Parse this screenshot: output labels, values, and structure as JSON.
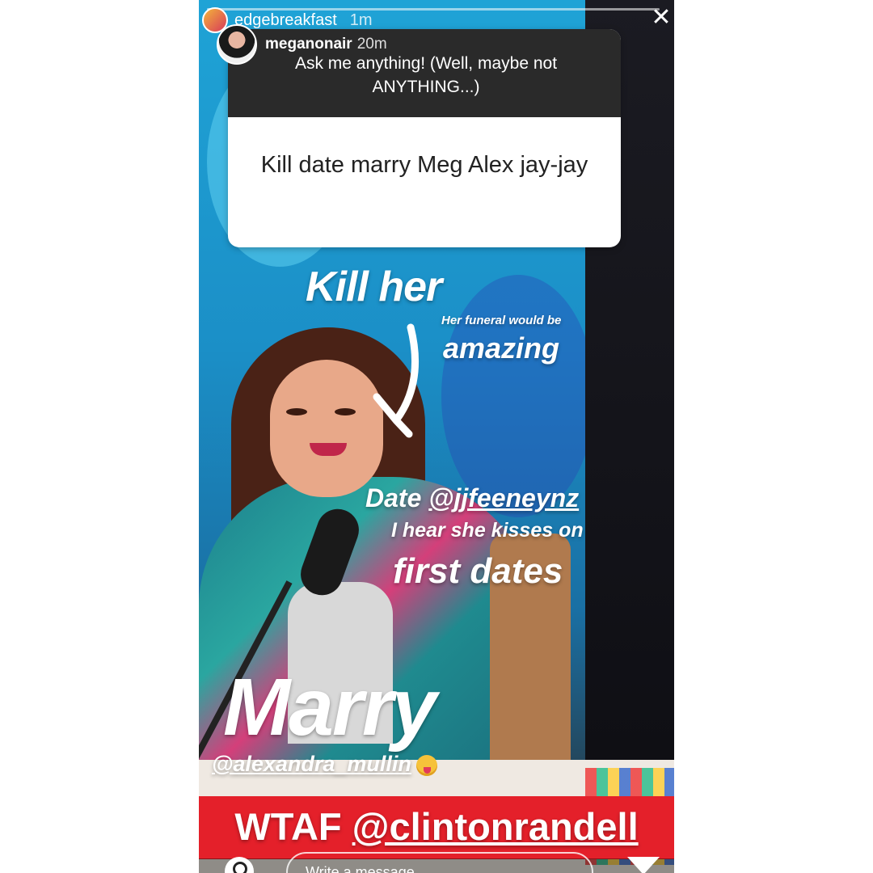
{
  "story_header": {
    "username": "edgebreakfast",
    "time": "1m"
  },
  "question_sticker": {
    "username": "meganonair",
    "time": "20m",
    "prompt": "Ask me anything! (Well, maybe not ANYTHING...)",
    "answer": "Kill date marry Meg Alex jay-jay"
  },
  "overlays": {
    "kill": "Kill her",
    "funeral_small": "Her funeral would be",
    "funeral_big": "amazing",
    "date_prefix": "Date ",
    "date_mention": "@jjfeeneynz",
    "date_line2": "I hear she kisses on",
    "date_line3": "first dates",
    "marry": "Marry",
    "marry_mention": "@alexandra_mullin",
    "wtaf_prefix": "WTAF ",
    "wtaf_mention": "@clintonrandell"
  },
  "message_input": {
    "placeholder": "Write a message..."
  },
  "colors": {
    "banner_red": "#e4202a",
    "card_dark": "#2a2a2a",
    "studio_blue": "#1fa3d6"
  },
  "icons": {
    "close": "close-icon",
    "camera": "camera-icon",
    "send": "send-icon",
    "emoji": "winking-tongue-emoji-icon"
  }
}
